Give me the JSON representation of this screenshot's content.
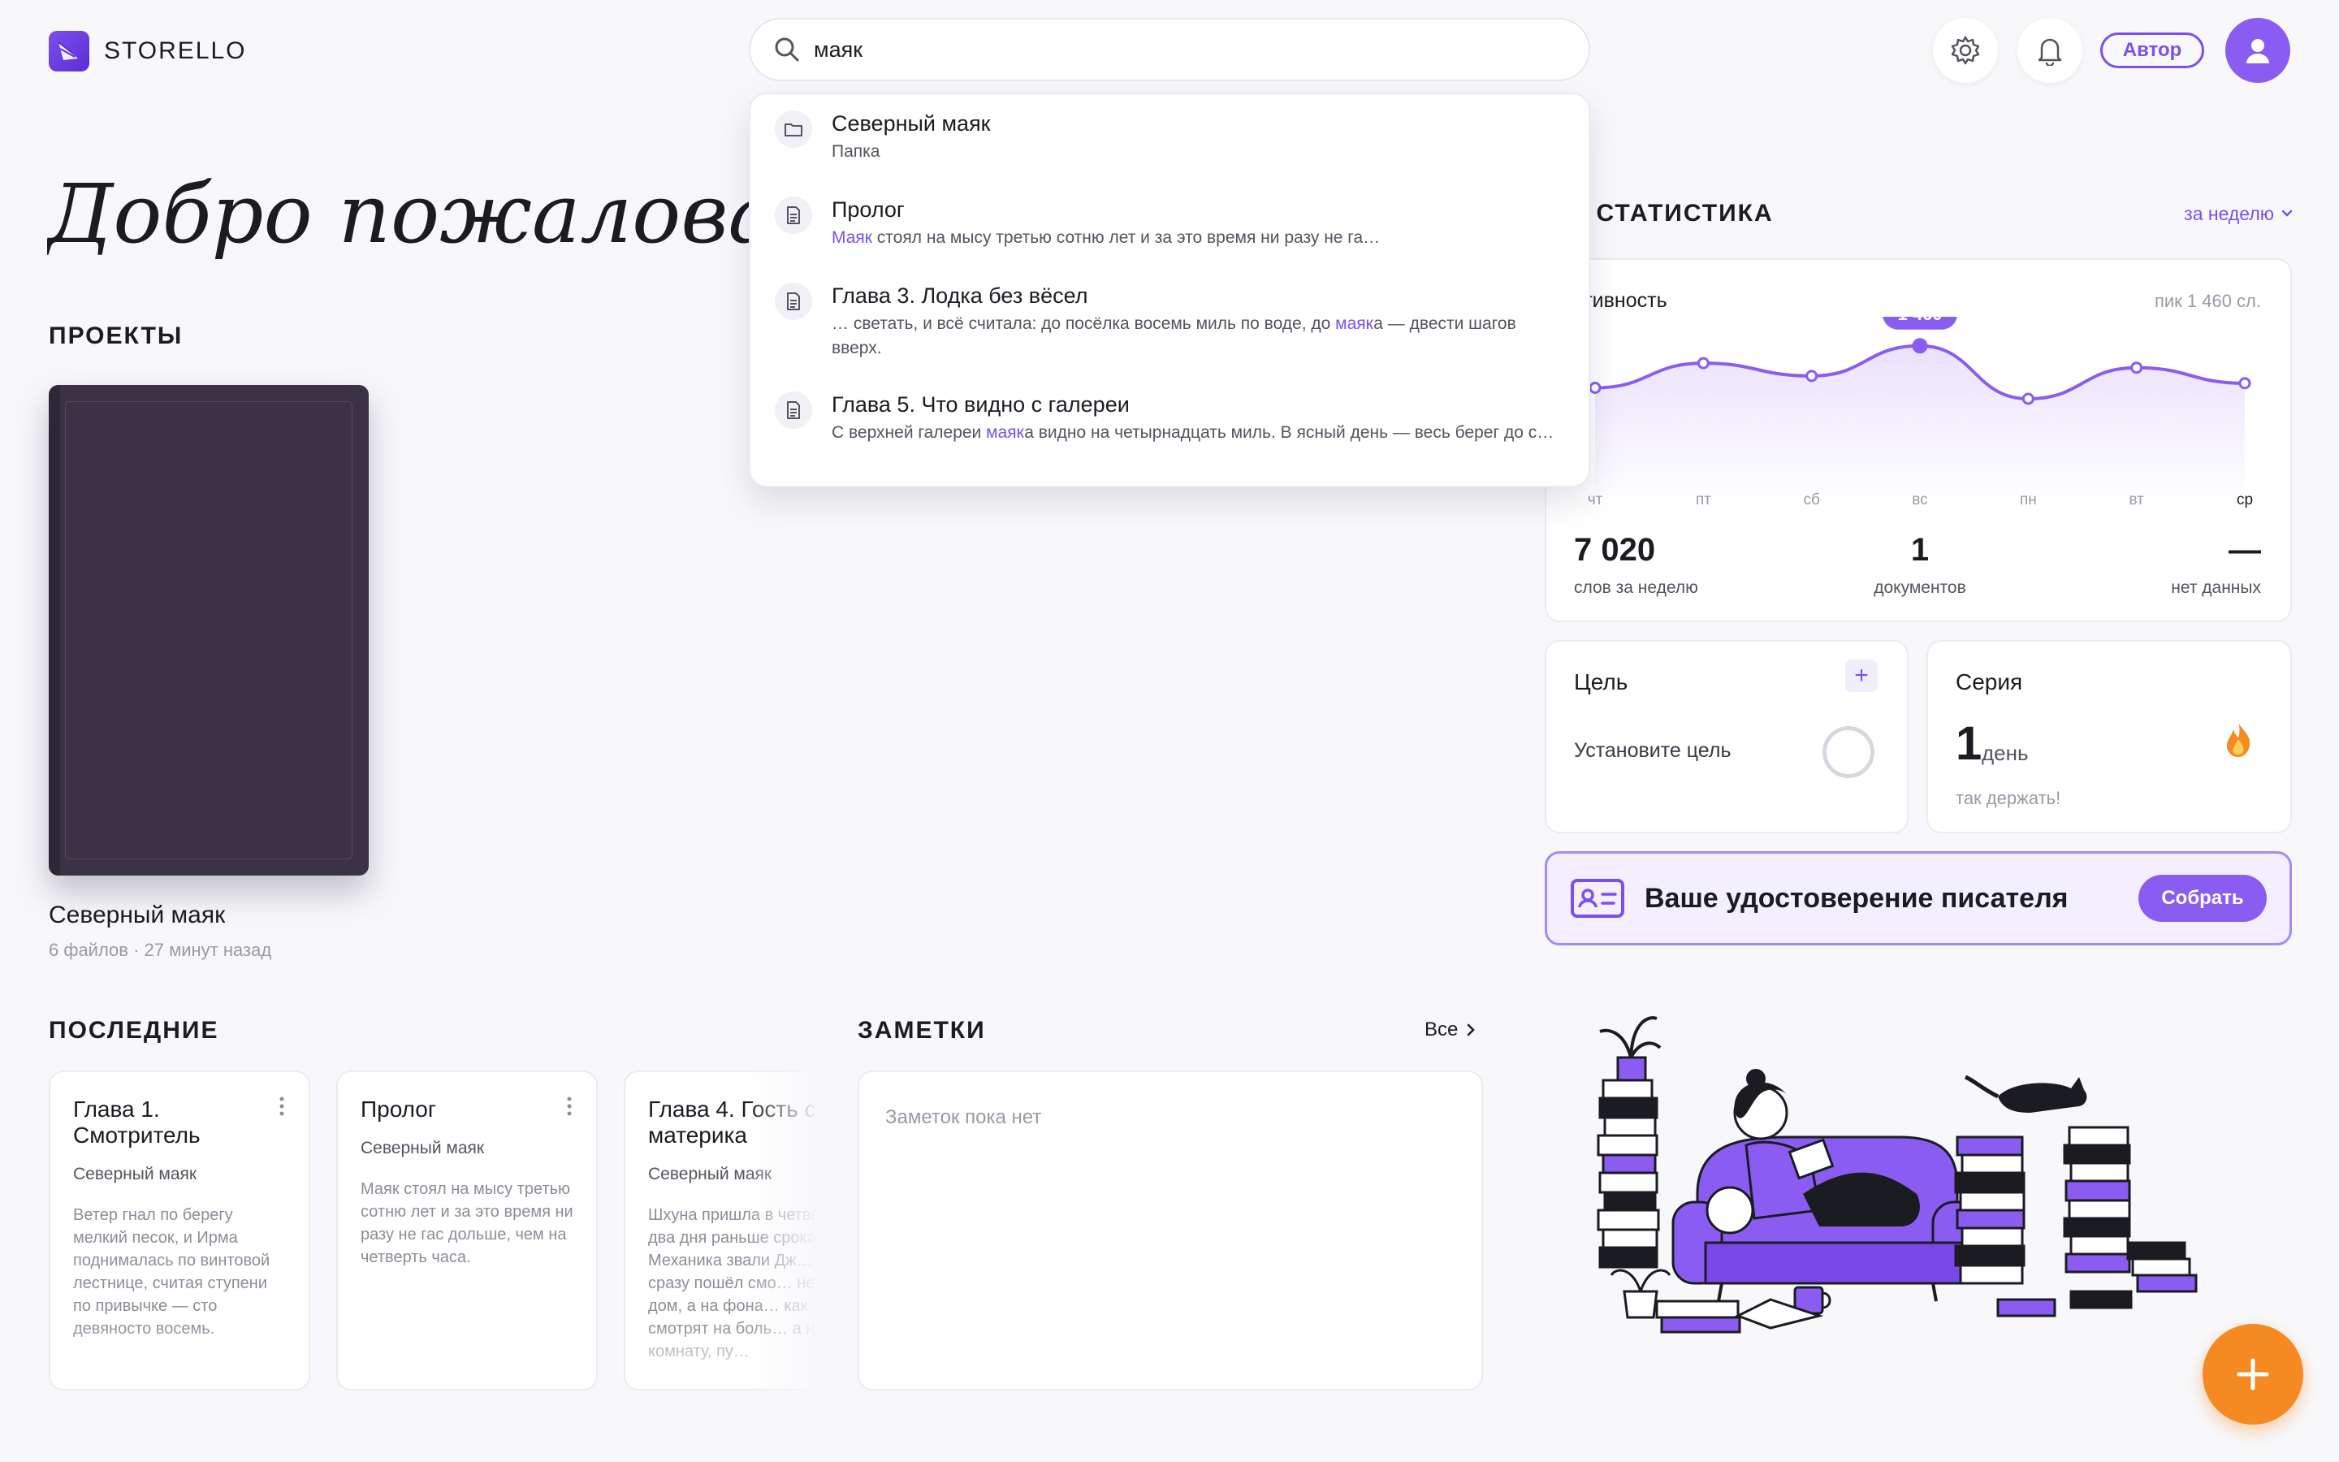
{
  "app": {
    "name": "STORELLO"
  },
  "search": {
    "value": "маяк",
    "placeholder": ""
  },
  "header": {
    "author_label": "Автор"
  },
  "welcome": "Добро пожаловать, М",
  "projects": {
    "title": "ПРОЕКТЫ",
    "items": [
      {
        "name": "Северный маяк",
        "meta": "6 файлов · 27 минут назад"
      }
    ]
  },
  "recent": {
    "title": "ПОСЛЕДНИЕ",
    "items": [
      {
        "title": "Глава 1. Смотритель",
        "project": "Северный маяк",
        "excerpt": "Ветер гнал по берегу мелкий песок, и Ирма поднималась по винтовой лестнице, считая ступени по привычке — сто девяносто восемь."
      },
      {
        "title": "Пролог",
        "project": "Северный маяк",
        "excerpt": "Маяк стоял на мысу третью сотню лет и за это время ни разу не гас дольше, чем на четверть часа."
      },
      {
        "title": "Глава 4. Гость с материка",
        "project": "Северный маяк",
        "excerpt": "Шхуна пришла в четверг, на два дня раньше срока. Механика звали Дж… он сразу пошёл смо… не на дом, а на фона… как смотрят на боль… а не на комнату, пу…"
      }
    ]
  },
  "notes": {
    "title": "ЗАМЕТКИ",
    "all_label": "Все",
    "empty": "Заметок пока нет"
  },
  "stats": {
    "title": "ЯЯ СТАТИСТИКА",
    "period": "за неделю",
    "activity_label": "ктивность",
    "peak": "пик 1 460 сл.",
    "peak_badge": "1 460",
    "totals": [
      {
        "value": "7 020",
        "label": "слов за неделю"
      },
      {
        "value": "1",
        "label": "документов"
      },
      {
        "value": "—",
        "label": "нет данных"
      }
    ]
  },
  "chart_data": {
    "type": "line",
    "categories": [
      "чт",
      "пт",
      "сб",
      "вс",
      "пн",
      "вт",
      "ср"
    ],
    "series": [
      {
        "values": [
          1000,
          1270,
          1130,
          1460,
          880,
          1220,
          1050
        ]
      }
    ],
    "ylim": [
      0,
      1600
    ],
    "annotations": [
      "1 460"
    ],
    "highlight_category": "ср"
  },
  "goal": {
    "title": "Цель",
    "set_label": "Установите цель"
  },
  "streak": {
    "title": "Серия",
    "value": "1",
    "unit": "день",
    "note": "так держать!"
  },
  "badge": {
    "text": "Ваше удостоверение писателя",
    "button": "Собрать"
  },
  "search_results": [
    {
      "title": "Северный маяк",
      "sub_pre": "",
      "sub_hl": "",
      "sub_post": "Папка",
      "icon": "folder-icon"
    },
    {
      "title": "Пролог",
      "sub_pre": "",
      "sub_hl": "Маяк",
      "sub_post": " стоял на мысу третью сотню лет и за это время ни разу не га…",
      "icon": "document-icon"
    },
    {
      "title": "Глава 3. Лодка без вёсел",
      "sub_pre": "… светать, и всё считала: до посёлка восемь миль по воде, до ",
      "sub_hl": "маяк",
      "sub_post": "а — двести шагов вверх.",
      "icon": "document-icon"
    },
    {
      "title": "Глава 5. Что видно с галереи",
      "sub_pre": "С верхней галереи ",
      "sub_hl": "маяк",
      "sub_post": "а видно на четырнадцать миль. В ясный день — весь берег до с…",
      "icon": "document-icon"
    }
  ],
  "colors": {
    "accent": "#7b4ff0",
    "fab": "#f58a22",
    "book": "#3b3345"
  },
  "icons": [
    "search-icon",
    "gear-icon",
    "bell-icon",
    "user-icon",
    "folder-icon",
    "document-icon",
    "chevron-down-icon",
    "chevron-right-icon",
    "plus-icon",
    "flame-icon",
    "id-card-icon"
  ]
}
